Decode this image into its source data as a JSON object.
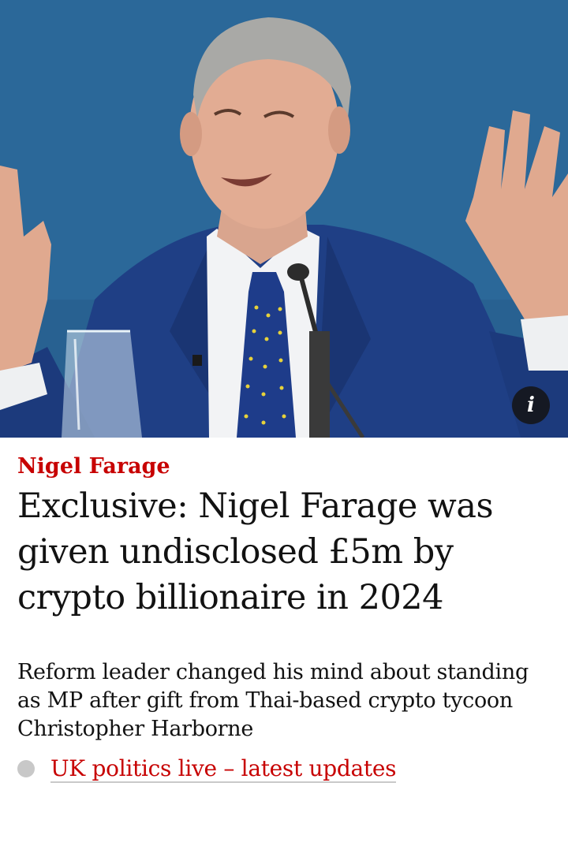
{
  "hero": {
    "info_icon": "info-icon",
    "info_glyph": "i",
    "colors": {
      "background": "#2a6597",
      "suit": "#1e3f86",
      "tie": "#1e3c8a"
    }
  },
  "article": {
    "kicker": "Nigel Farage",
    "headline": "Exclusive: Nigel Farage was given undisclosed £5m by crypto billionaire in 2024",
    "standfirst": "Reform leader changed his mind about standing as MP after gift from Thai-based crypto tycoon Christopher Harborne",
    "live_link": "UK politics live – latest updates"
  },
  "colors": {
    "accent": "#c70000",
    "text": "#121212",
    "live_dot": "#c8c8c8"
  }
}
